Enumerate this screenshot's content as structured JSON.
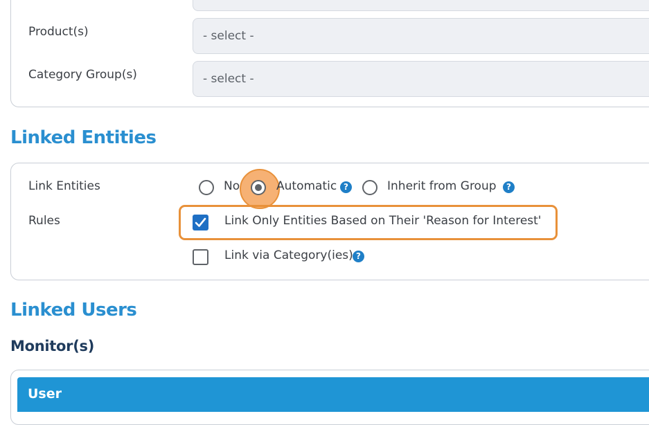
{
  "filters": {
    "product_label": "Product(s)",
    "product_value": "- select -",
    "category_group_label": "Category Group(s)",
    "category_group_value": "- select -"
  },
  "linked_entities": {
    "title": "Linked Entities",
    "link_entities_label": "Link Entities",
    "options": [
      {
        "label": "No",
        "selected": false
      },
      {
        "label": "Automatic",
        "selected": true,
        "help": "?"
      },
      {
        "label": "Inherit from Group",
        "selected": false,
        "help": "?"
      }
    ],
    "rules_label": "Rules",
    "rules": [
      {
        "label": "Link Only Entities Based on Their 'Reason for Interest'",
        "checked": true
      },
      {
        "label": "Link via Category(ies)",
        "checked": false,
        "help": "?"
      }
    ]
  },
  "linked_users": {
    "title": "Linked Users",
    "monitors_title": "Monitor(s)",
    "table_header": "User"
  },
  "colors": {
    "accent": "#2a8fd0",
    "header_bg": "#1f95d5",
    "highlight": "#e8913a",
    "checkbox": "#1e6fc4"
  }
}
